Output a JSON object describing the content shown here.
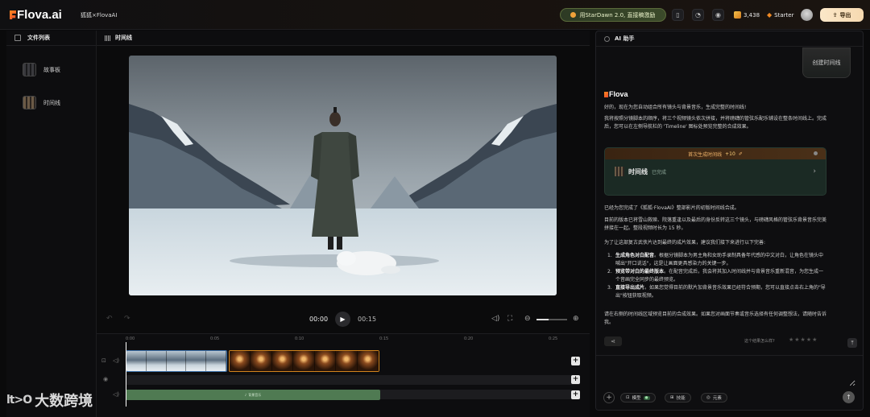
{
  "topbar": {
    "logo_text": "Flova.ai",
    "breadcrumb": "狐狐×FlovaAI",
    "promo_label": "用StarDawn 2.0, 直接稿激励",
    "credits": "3,438",
    "plan": "Starter",
    "export_label": "导出",
    "accent_color": "#f08a24"
  },
  "left_panel": {
    "title": "文件列表",
    "items": [
      {
        "label": "故事板",
        "icon": "storyboard-icon"
      },
      {
        "label": "时间线",
        "icon": "timeline-icon"
      }
    ]
  },
  "center": {
    "title": "时间线",
    "current_time": "00:00",
    "total_time": "00:15",
    "zoom_level": 0.4,
    "ruler_ticks": [
      "0:00",
      "0:05",
      "0:10",
      "0:15",
      "0:20",
      "0:25"
    ],
    "audio_clip_label": "背景音乐"
  },
  "assistant": {
    "title": "AI 助手",
    "user_message": "创建时间线",
    "brand": "Flova",
    "p1": "好的，现在为您自动组合所有镜头与背景音乐，生成完整的时间线!",
    "p2": "我将按照分镜脚本的顺序，将三个视频镜头依次拼接，并将磅礴的管弦乐配乐铺设在整条时间线上。完成后，您可以在左侧导航栏的 'Timeline' 图标处预览完整的合成效果。",
    "card_top": "首次生成时间线",
    "card_bonus": "+10",
    "card_title": "时间线",
    "card_status": "已完成",
    "p3": "已经为您完成了《狐狐·FlovaAI》整部影片的初版时间线合成。",
    "p4": "目前的版本已将雪山救赎、院落重逢以及最后的身份反转这三个镜头，与磅礴风格的管弦乐背景音乐完美拼接在一起。整段视频时长为 15 秒。",
    "p5": "为了让这部复古武侠片达到最终的成片效果，建议我们接下来进行以下完善:",
    "steps": [
      {
        "num": "1.",
        "title": "生成角色对白配音",
        "text": "。根据分镜脚本为男主角和女助手录制具备年代感的中文对白，让角色在镜头中喊出\"开口说话\"，这是让画面更具感染力的关键一步。"
      },
      {
        "num": "2.",
        "title": "预览带对白的最终版本",
        "text": "。在配音完成后，我会将其加入时间线并与背景音乐重新混音，为您生成一个音画完全同步的最终预览。"
      },
      {
        "num": "3.",
        "title": "直接导出成片",
        "text": "。如果您觉得目前的默片加背景音乐效果已经符合预期，您可以直接点击右上角的\"导出\"按钮获取视频。"
      }
    ],
    "p6": "请在右侧的时间线区域预览目前的合成效果。如果您对画面节奏或音乐选择有任何调整想法，请随时告诉我。",
    "feedback_prompt": "这个结果怎么样?",
    "input_placeholder": "",
    "chips": [
      {
        "label": "模型",
        "tag": "●"
      },
      {
        "label": "技能",
        "tag": ""
      },
      {
        "label": "元素",
        "tag": ""
      }
    ]
  },
  "watermark": {
    "icon_text": "lt>O",
    "text": "大数跨境"
  }
}
